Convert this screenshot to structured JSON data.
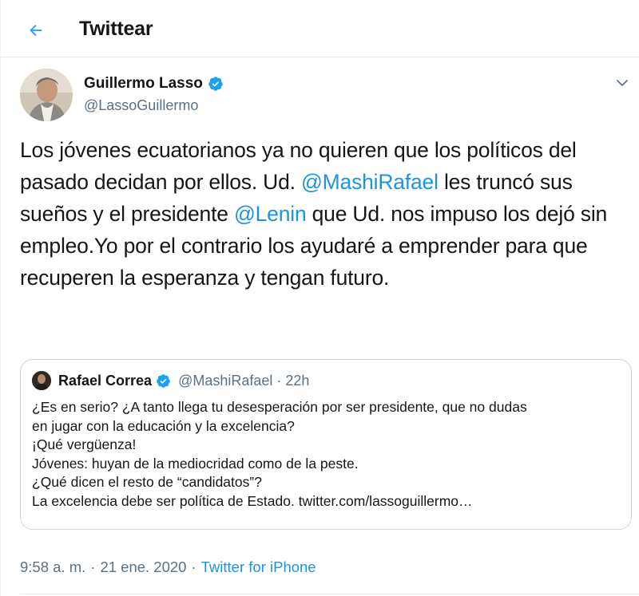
{
  "header": {
    "title": "Twittear",
    "back_icon": "arrow-left-icon",
    "accent": "#1da1f2"
  },
  "tweet": {
    "author_name": "Guillermo Lasso",
    "author_handle": "@LassoGuillermo",
    "verified_icon": "verified-badge-icon",
    "text_parts": {
      "p1": "Los jóvenes ecuatorianos ya no quieren que los políticos del pasado decidan por ellos. Ud. ",
      "m1": "@MashiRafael",
      "p2": " les truncó sus sueños y el presidente ",
      "m2": "@Lenin",
      "p3": " que Ud. nos impuso los dejó sin empleo.Yo por el contrario los ayudaré a emprender para que recuperen la esperanza y tengan futuro."
    },
    "time": "9:58 a. m.",
    "separator": "·",
    "date": "21 ene. 2020",
    "source": "Twitter for iPhone",
    "link_color": "#1b95e0"
  },
  "quoted": {
    "author_name": "Rafael Correa",
    "author_handle": "@MashiRafael",
    "separator": "·",
    "time": "22h",
    "lines": [
      "¿Es en serio? ¿A tanto llega tu desesperación por ser presidente, que no dudas",
      "en jugar con la educación y la excelencia?",
      "¡Qué vergüenza!",
      "Jóvenes: huyan de la mediocridad como de la peste.",
      "¿Qué dicen el resto de “candidatos”?",
      "La excelencia debe ser política de Estado. twitter.com/lassoguillermo…"
    ]
  }
}
